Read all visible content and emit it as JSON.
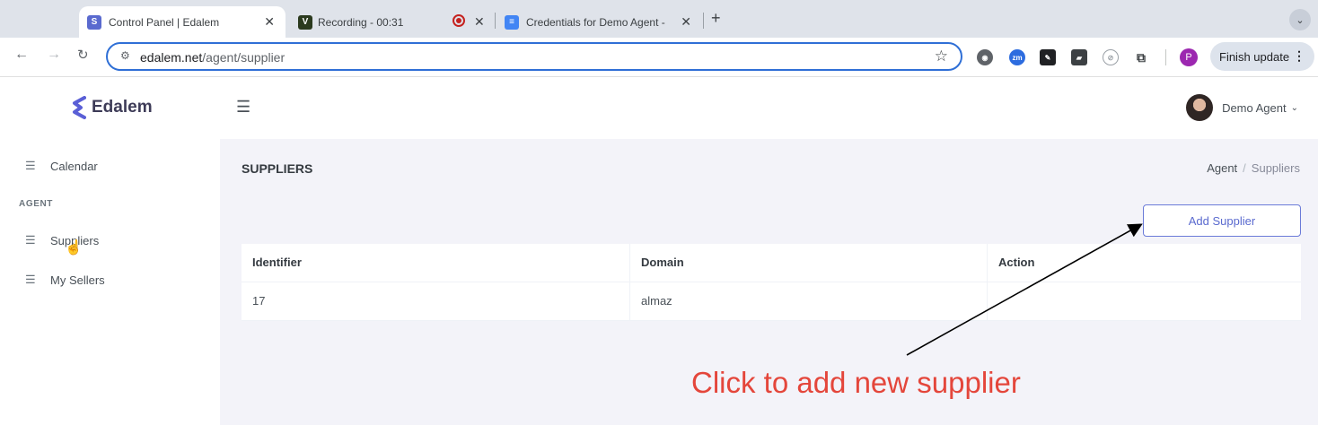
{
  "browser": {
    "tabs": [
      {
        "title": "Control Panel | Edalem",
        "active": true
      },
      {
        "title": "Recording - 00:31",
        "active": false
      },
      {
        "title": "Credentials for Demo Agent -",
        "active": false
      }
    ],
    "url_host": "edalem.net",
    "url_path": "/agent/supplier",
    "profile_initial": "P",
    "finish_update_label": "Finish update"
  },
  "app": {
    "logo_text": "Edalem",
    "user_name": "Demo Agent"
  },
  "sidebar": {
    "items": [
      {
        "label": "Calendar"
      },
      {
        "label": "Suppliers"
      },
      {
        "label": "My Sellers"
      }
    ],
    "section_label": "AGENT"
  },
  "page": {
    "title": "SUPPLIERS",
    "breadcrumb": [
      "Agent",
      "Suppliers"
    ],
    "add_button_label": "Add Supplier",
    "table": {
      "headers": [
        "Identifier",
        "Domain",
        "Action"
      ],
      "rows": [
        [
          "17",
          "almaz",
          ""
        ]
      ]
    }
  },
  "annotation": {
    "text": "Click to add new supplier",
    "color": "#e4463b"
  },
  "colors": {
    "accent": "#5a6acf",
    "omnibox_border": "#2f6fd6"
  }
}
